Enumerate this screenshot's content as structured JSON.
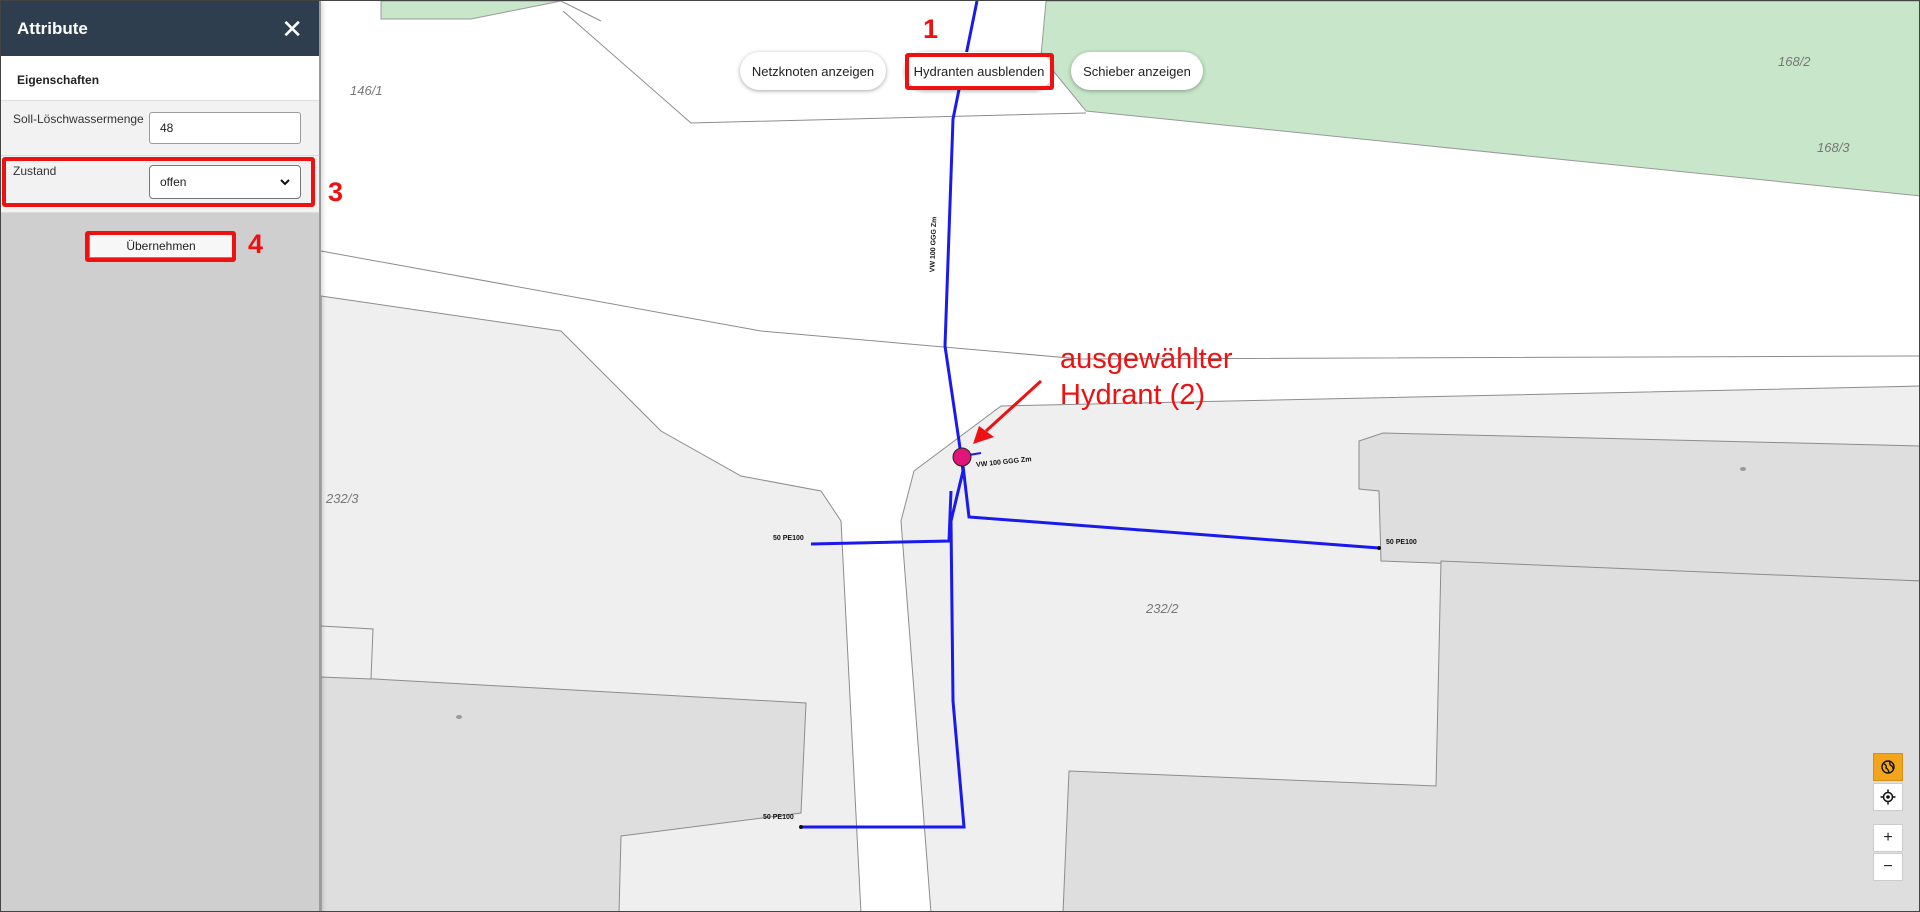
{
  "sidebar": {
    "title": "Attribute",
    "close_glyph": "✕",
    "section_heading": "Eigenschaften",
    "fields": [
      {
        "label": "Soll-Löschwassermenge",
        "value": "48"
      },
      {
        "label": "Zustand",
        "value": "offen"
      }
    ],
    "apply_label": "Übernehmen"
  },
  "toolbar": {
    "netzknoten_label": "Netzknoten anzeigen",
    "hydranten_label": "Hydranten ausblenden",
    "schieber_label": "Schieber anzeigen"
  },
  "annotations": {
    "n1": "1",
    "n3": "3",
    "n4": "4",
    "hydrant_line1": "ausgewählter",
    "hydrant_line2": "Hydrant (2)"
  },
  "parcels": {
    "p1": "146/1",
    "p2": "168/2",
    "p3": "168/3",
    "p4": "232/3",
    "p5": "232/2"
  },
  "pipes": {
    "main_vertical": "VW 100 GGG Zm",
    "main_branch": "VW 100 GGG Zm",
    "left_branch": "50 PE100",
    "right_branch": "50 PE100",
    "bottom_branch": "50 PE100"
  },
  "map_controls": {
    "globe_icon": "globe-icon",
    "locate_icon": "locate-icon",
    "zoom_in": "+",
    "zoom_out": "−"
  },
  "colors": {
    "header_bg": "#2f3e4e",
    "highlight_red": "#ee1111",
    "pipe_blue": "#1a1aee",
    "hydrant_magenta": "#e0157a",
    "green_area": "#c8e6c9",
    "globe_active": "#f2a51a"
  }
}
